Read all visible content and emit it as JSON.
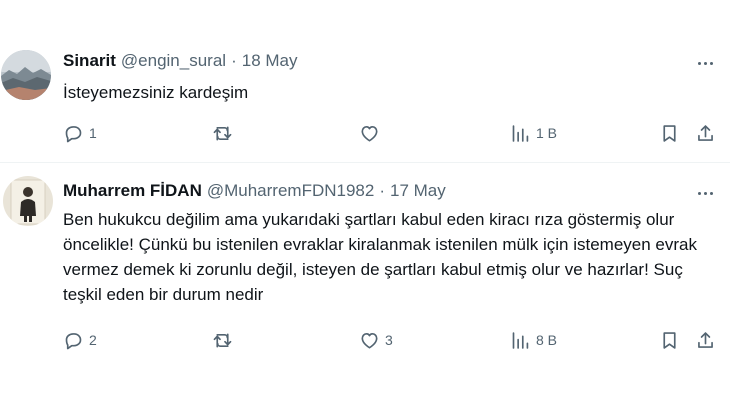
{
  "tweets": [
    {
      "name": "Sinarit",
      "handle": "@engin_sural",
      "separator": "·",
      "date": "18 May",
      "text": "İsteyemezsiniz kardeşim",
      "replies": "1",
      "retweets": "",
      "likes": "",
      "views": "1 B"
    },
    {
      "name": "Muharrem FİDAN",
      "handle": "@MuharremFDN1982",
      "separator": "·",
      "date": "17 May",
      "text": "Ben hukukcu değilim ama yukarıdaki şartları kabul eden kiracı rıza göstermiş olur öncelikle! Çünkü bu istenilen evraklar kiralanmak istenilen mülk için istemeyen evrak vermez demek ki zorunlu değil, isteyen de şartları kabul etmiş olur ve hazırlar! Suç teşkil eden bir durum nedir",
      "replies": "2",
      "retweets": "",
      "likes": "3",
      "views": "8 B"
    }
  ],
  "icons": {
    "reply": "reply-icon",
    "retweet": "retweet-icon",
    "like": "like-icon",
    "views": "views-icon",
    "bookmark": "bookmark-icon",
    "share": "share-icon",
    "more": "more-icon"
  },
  "colors": {
    "primary_text": "#0f1419",
    "secondary_text": "#536471",
    "divider": "#eff3f4"
  }
}
